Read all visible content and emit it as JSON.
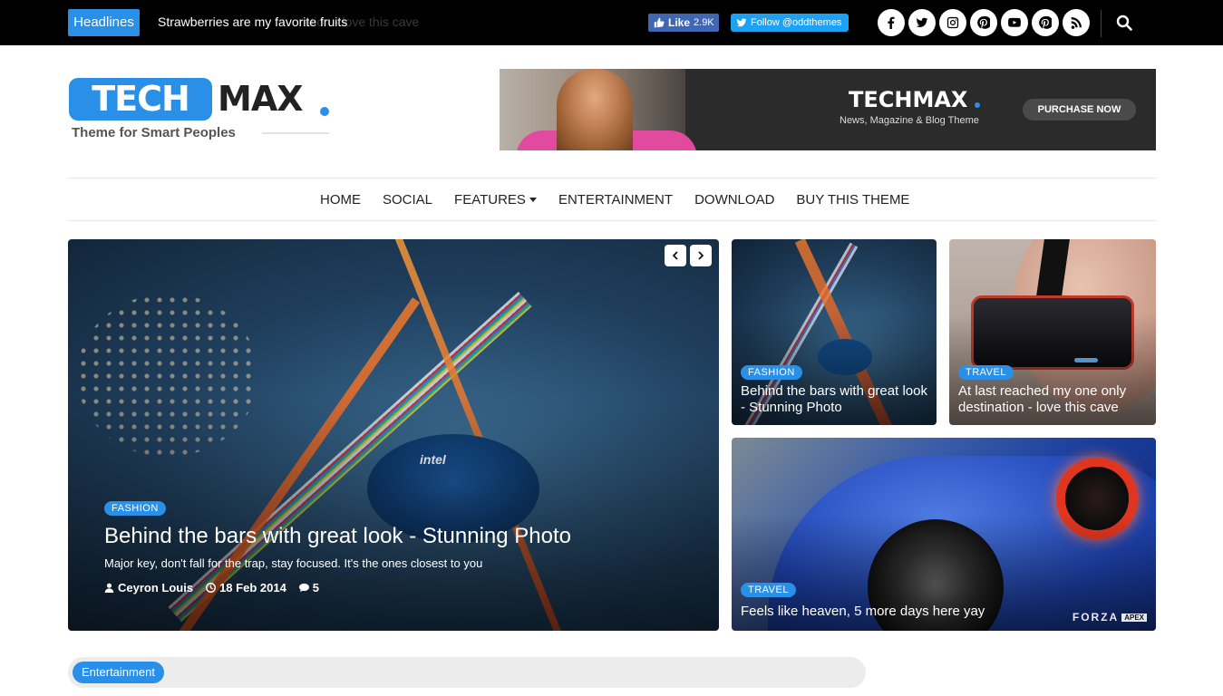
{
  "topbar": {
    "headlines_label": "Headlines",
    "ticker_text": "Strawberries are my favorite fruits",
    "ticker_ghost": "ration - love this cave",
    "fb_like_label": "Like",
    "fb_like_count": "2.9K",
    "twitter_follow_label": "Follow @oddthemes",
    "social_icons": [
      "facebook-icon",
      "twitter-icon",
      "instagram-icon",
      "pinterest-icon",
      "youtube-icon",
      "pinterest-icon",
      "rss-icon"
    ]
  },
  "logo": {
    "tech": "TECH",
    "max": "MAX",
    "tagline": "Theme for Smart Peoples"
  },
  "banner": {
    "brand": "TECHMAX",
    "subtitle": "News, Magazine & Blog Theme",
    "button": "PURCHASE NOW"
  },
  "nav": {
    "items": [
      "HOME",
      "SOCIAL",
      "FEATURES",
      "ENTERTAINMENT",
      "DOWNLOAD",
      "BUY THIS THEME"
    ]
  },
  "featured": {
    "main": {
      "category": "FASHION",
      "title": "Behind the bars with great look - Stunning Photo",
      "excerpt": "Major key, don't fall for the trap, stay focused. It's the ones closest to you",
      "author": "Ceyron Louis",
      "date": "18 Feb 2014",
      "comments": "5",
      "chip_text": "intel"
    },
    "small1": {
      "category": "FASHION",
      "title": "Behind the bars with great look - Stunning Photo"
    },
    "small2": {
      "category": "TRAVEL",
      "title": "At last reached my one only destination - love this cave"
    },
    "wide": {
      "category": "TRAVEL",
      "title": "Feels like heaven, 5 more days here yay",
      "watermark": "FORZA",
      "watermark_tag": "APEX"
    }
  },
  "section": {
    "label": "Entertainment"
  },
  "colors": {
    "accent": "#2a8fe6",
    "topbar_bg": "#000000",
    "facebook": "#4267b2",
    "twitter": "#1da1f2"
  }
}
